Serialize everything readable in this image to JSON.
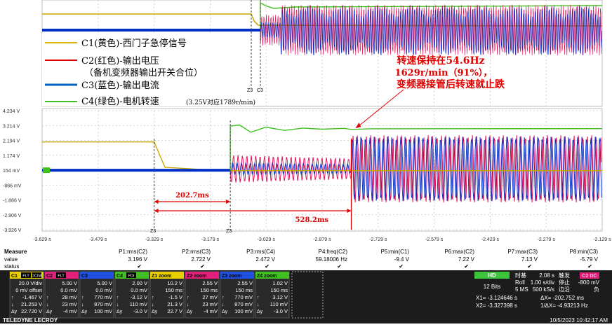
{
  "colors": {
    "c1": "#c8a800",
    "c2": "#e0004c",
    "c3": "#0030c8",
    "c4": "#40c020",
    "annot": "#e00000",
    "grid": "#c8c8c8"
  },
  "legend": [
    {
      "label": "C1(黄色)-西门子急停信号",
      "color": "#d8b400",
      "note": ""
    },
    {
      "label": "C2(红色)-输出电压",
      "color": "#e00000",
      "note": ""
    },
    {
      "label": "（备机变频器输出开关合位）",
      "color": "",
      "note": ""
    },
    {
      "label": "C3(蓝色)-输出电流",
      "color": "#0060c0",
      "note": ""
    },
    {
      "label": "C4(绿色)-电机转速",
      "color": "#40c020",
      "note": "(3.25V对应1789r/min)"
    }
  ],
  "annotation": {
    "line1": "转速保持在54.6Hz",
    "line2": "1629r/min（91%），",
    "line3": "变频器接管后转速就止跌"
  },
  "cursor_tags": {
    "top_a": "Z3",
    "top_b": "C3",
    "top_c": "C3",
    "bot_a": "Z3",
    "bot_b": "Z3"
  },
  "chart_data": {
    "type": "line",
    "x_unit": "s",
    "xlim": [
      -3.629,
      -2.129
    ],
    "ylim": [
      -3.926,
      4.234
    ],
    "x_tick_labels": [
      "-3.629 s",
      "-3.479 s",
      "-3.329 s",
      "-3.179 s",
      "-3.029 s",
      "-2.879 s",
      "-2.729 s",
      "-2.579 s",
      "-2.429 s",
      "-2.279 s",
      "-2.129 s"
    ],
    "y_tick_labels": [
      "4.234 V",
      "3.214 V",
      "2.194 V",
      "1.174 V",
      "154 mV",
      "-866 mV",
      "-1.886 V",
      "-2.906 V",
      "-3.926 V"
    ],
    "events": {
      "estop_x": -3.329,
      "speed_feedback_x": -3.125,
      "drive_takeover_x": -2.801,
      "interval1_label": "202.7ms",
      "interval2_label": "528.2ms"
    },
    "series": [
      {
        "name": "C1",
        "points": [
          [
            -3.629,
            2.09
          ],
          [
            -3.329,
            2.09
          ],
          [
            -3.3,
            0.35
          ],
          [
            -3.15,
            0.12
          ],
          [
            -2.129,
            0.12
          ]
        ]
      },
      {
        "name": "C4",
        "points": [
          [
            -3.629,
            0.16
          ],
          [
            -3.125,
            0.16
          ],
          [
            -3.125,
            3.18
          ],
          [
            -3.1,
            3.25
          ],
          [
            -3.07,
            2.75
          ],
          [
            -3.03,
            3.1
          ],
          [
            -2.98,
            2.88
          ],
          [
            -2.93,
            3.04
          ],
          [
            -2.88,
            2.96
          ],
          [
            -2.82,
            3.02
          ],
          [
            -2.801,
            2.95
          ],
          [
            -2.75,
            2.99
          ],
          [
            -2.129,
            3.0
          ]
        ]
      },
      {
        "name": "C2",
        "points": [
          [
            -3.629,
            0.15
          ],
          [
            -3.125,
            0.15
          ],
          [
            -3.124,
            1.2
          ],
          [
            -3.0,
            1.05
          ],
          [
            -2.802,
            0.9
          ],
          [
            -2.801,
            3.0
          ],
          [
            -2.129,
            3.0
          ]
        ]
      },
      {
        "name": "C3",
        "points": [
          [
            -3.629,
            0.15
          ],
          [
            -3.125,
            0.15
          ],
          [
            -3.124,
            0.4
          ],
          [
            -2.802,
            0.35
          ],
          [
            -2.801,
            2.95
          ],
          [
            -2.129,
            2.95
          ]
        ]
      }
    ]
  },
  "measure": {
    "header": [
      "Measure",
      "P1:rms(C2)",
      "P2:rms(C3)",
      "P3:rms(C4)",
      "P4:freq(C2)",
      "P5:min(C1)",
      "P6:max(C2)",
      "P7:max(C3)",
      "P8:min(C3)"
    ],
    "value_label": "value",
    "values": [
      "3.196 V",
      "2.722 V",
      "2.472 V",
      "59.18006 Hz",
      "-9.4 V",
      "7.22 V",
      "7.13 V",
      "-5.79 V"
    ],
    "status_label": "status"
  },
  "channels": [
    {
      "tag": "C1",
      "flags": [
        "FLT",
        "DCIM"
      ],
      "color": "#e8d000",
      "lines": [
        "20.0 V/div",
        "0 mV offset",
        "-1.467 V",
        "21.253 V",
        "22.720 V"
      ]
    },
    {
      "tag": "C2",
      "flags": [
        "FLT"
      ],
      "color": "#e0207a",
      "lines": [
        "5.00 V",
        "0.0 mV",
        "28 mV",
        "23 mV",
        "-4 mV"
      ]
    },
    {
      "tag": "C3",
      "flags": [],
      "color": "#2050e0",
      "lines": [
        "5.00 V",
        "0.0 mV",
        "770 mV",
        "870 mV",
        "100 mV"
      ]
    },
    {
      "tag": "C4",
      "flags": [
        "FDI"
      ],
      "color": "#40c020",
      "lines": [
        "2.00 V",
        "0.0 mV",
        "-3.12 V",
        "110 mV",
        "-3.0 V"
      ]
    },
    {
      "tag": "Z1 zoom",
      "flags": [],
      "color": "#e8d000",
      "lines": [
        "10.2 V",
        "150 ms",
        "-1.5 V",
        "21.3 V",
        "22.7 V"
      ]
    },
    {
      "tag": "Z2 zoom",
      "flags": [],
      "color": "#e0207a",
      "lines": [
        "2.55 V",
        "150 ms",
        "27 mV",
        "23 mV",
        "-4 mV"
      ]
    },
    {
      "tag": "Z3 zoom",
      "flags": [],
      "color": "#2050e0",
      "lines": [
        "2.55 V",
        "150 ms",
        "770 mV",
        "870 mV",
        "100 mV"
      ]
    },
    {
      "tag": "Z4 zoom",
      "flags": [],
      "color": "#40c020",
      "lines": [
        "1.02 V",
        "150 ms",
        "3.12 V",
        "110 mV",
        "-3.0 V"
      ]
    }
  ],
  "row_glyphs": [
    "↑",
    "↓",
    "Δy"
  ],
  "timebase": {
    "hd": "HD",
    "bits": "12 Bits",
    "label1": "时基",
    "value1": "2.08 s",
    "label2": "触发",
    "tag2": "C2 DC",
    "roll": "Roll",
    "roll_val": "1.00 s/div",
    "roll_stat": "停止",
    "trig_val": "-800 mV",
    "samples": "5 MS",
    "rate": "500 kS/s",
    "edge": "边沿",
    "slope": "负"
  },
  "cursors": {
    "x1": "X1= -3.124646 s",
    "x2": "X2= -3.327398 s",
    "dx": "ΔX= -202.752 ms",
    "fdx": "1/ΔX= -4.93213 Hz"
  },
  "footer": {
    "brand": "TELEDYNE LECROY",
    "datetime": "10/5/2023 10:42:17 AM"
  }
}
